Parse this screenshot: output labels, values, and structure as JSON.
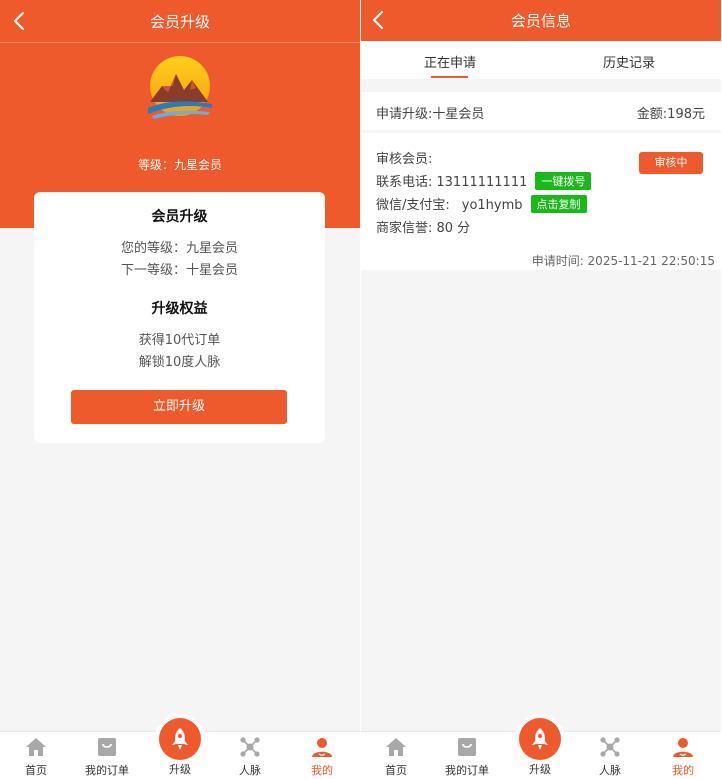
{
  "left": {
    "header_title": "会员升级",
    "level_line": "等级：九星会员",
    "card": {
      "section1_title": "会员升级",
      "current_level": "您的等级：九星会员",
      "next_level": "下一等级：十星会员",
      "section2_title": "升级权益",
      "benefit1": "获得10代订单",
      "benefit2": "解锁10度人脉",
      "upgrade_button": "立即升级"
    }
  },
  "right": {
    "header_title": "会员信息",
    "tabs": [
      "正在申请",
      "历史记录"
    ],
    "request": {
      "upgrade_label": "申请升级:十星会员",
      "amount_label": "金额:198元"
    },
    "detail": {
      "reviewer_label": "审核会员:",
      "phone_label": "联系电话:",
      "phone_value": "13111111111",
      "call_button": "一键拨号",
      "wechat_label": "微信/支付宝:",
      "wechat_value": "yo1hymb",
      "copy_button": "点击复制",
      "credit_label": "商家信誉: 80 分",
      "status_button": "审核中",
      "apply_time": "申请时间: 2025-11-21 22:50:15"
    }
  },
  "nav": {
    "home": "首页",
    "orders": "我的订单",
    "upgrade": "升级",
    "network": "人脉",
    "mine": "我的"
  },
  "colors": {
    "accent": "#ee5a2c",
    "tag_green": "#19b919",
    "icon_gray": "#a8a8a8"
  }
}
